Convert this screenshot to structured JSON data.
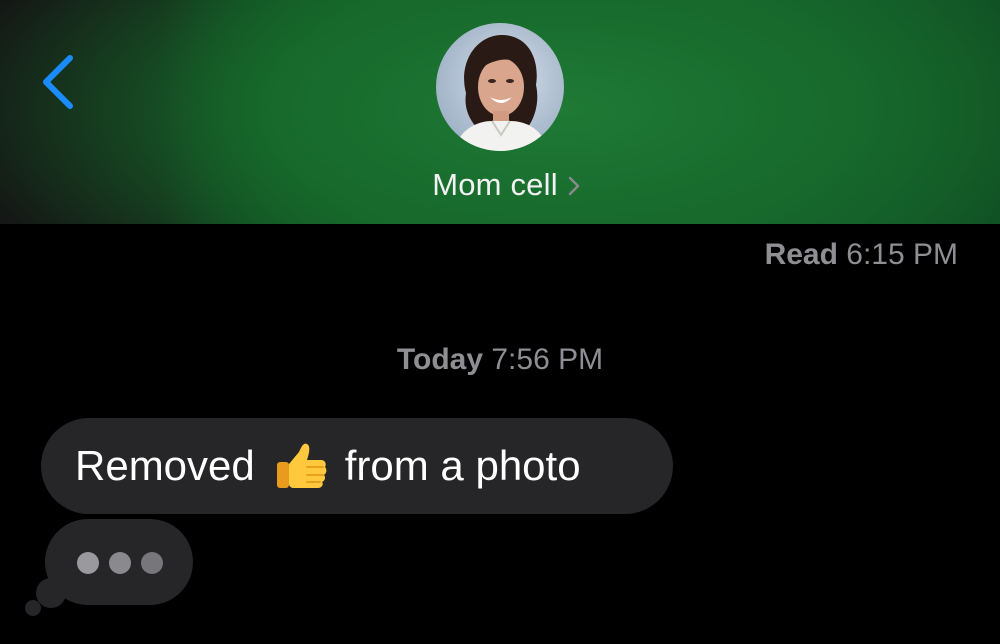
{
  "header": {
    "contact_name": "Mom cell",
    "back_icon": "chevron-left-icon",
    "disclosure_icon": "chevron-right-icon",
    "accent_color": "#1a8cff"
  },
  "thread": {
    "read_receipt": {
      "label": "Read",
      "time": "6:15 PM"
    },
    "timestamp": {
      "day": "Today",
      "time": "7:56 PM"
    },
    "messages": [
      {
        "direction": "incoming",
        "text_before": "Removed",
        "emoji": "👍",
        "emoji_icon": "thumbs-up-icon",
        "text_after": "from a photo"
      }
    ],
    "typing_indicator": {
      "visible": true
    }
  }
}
